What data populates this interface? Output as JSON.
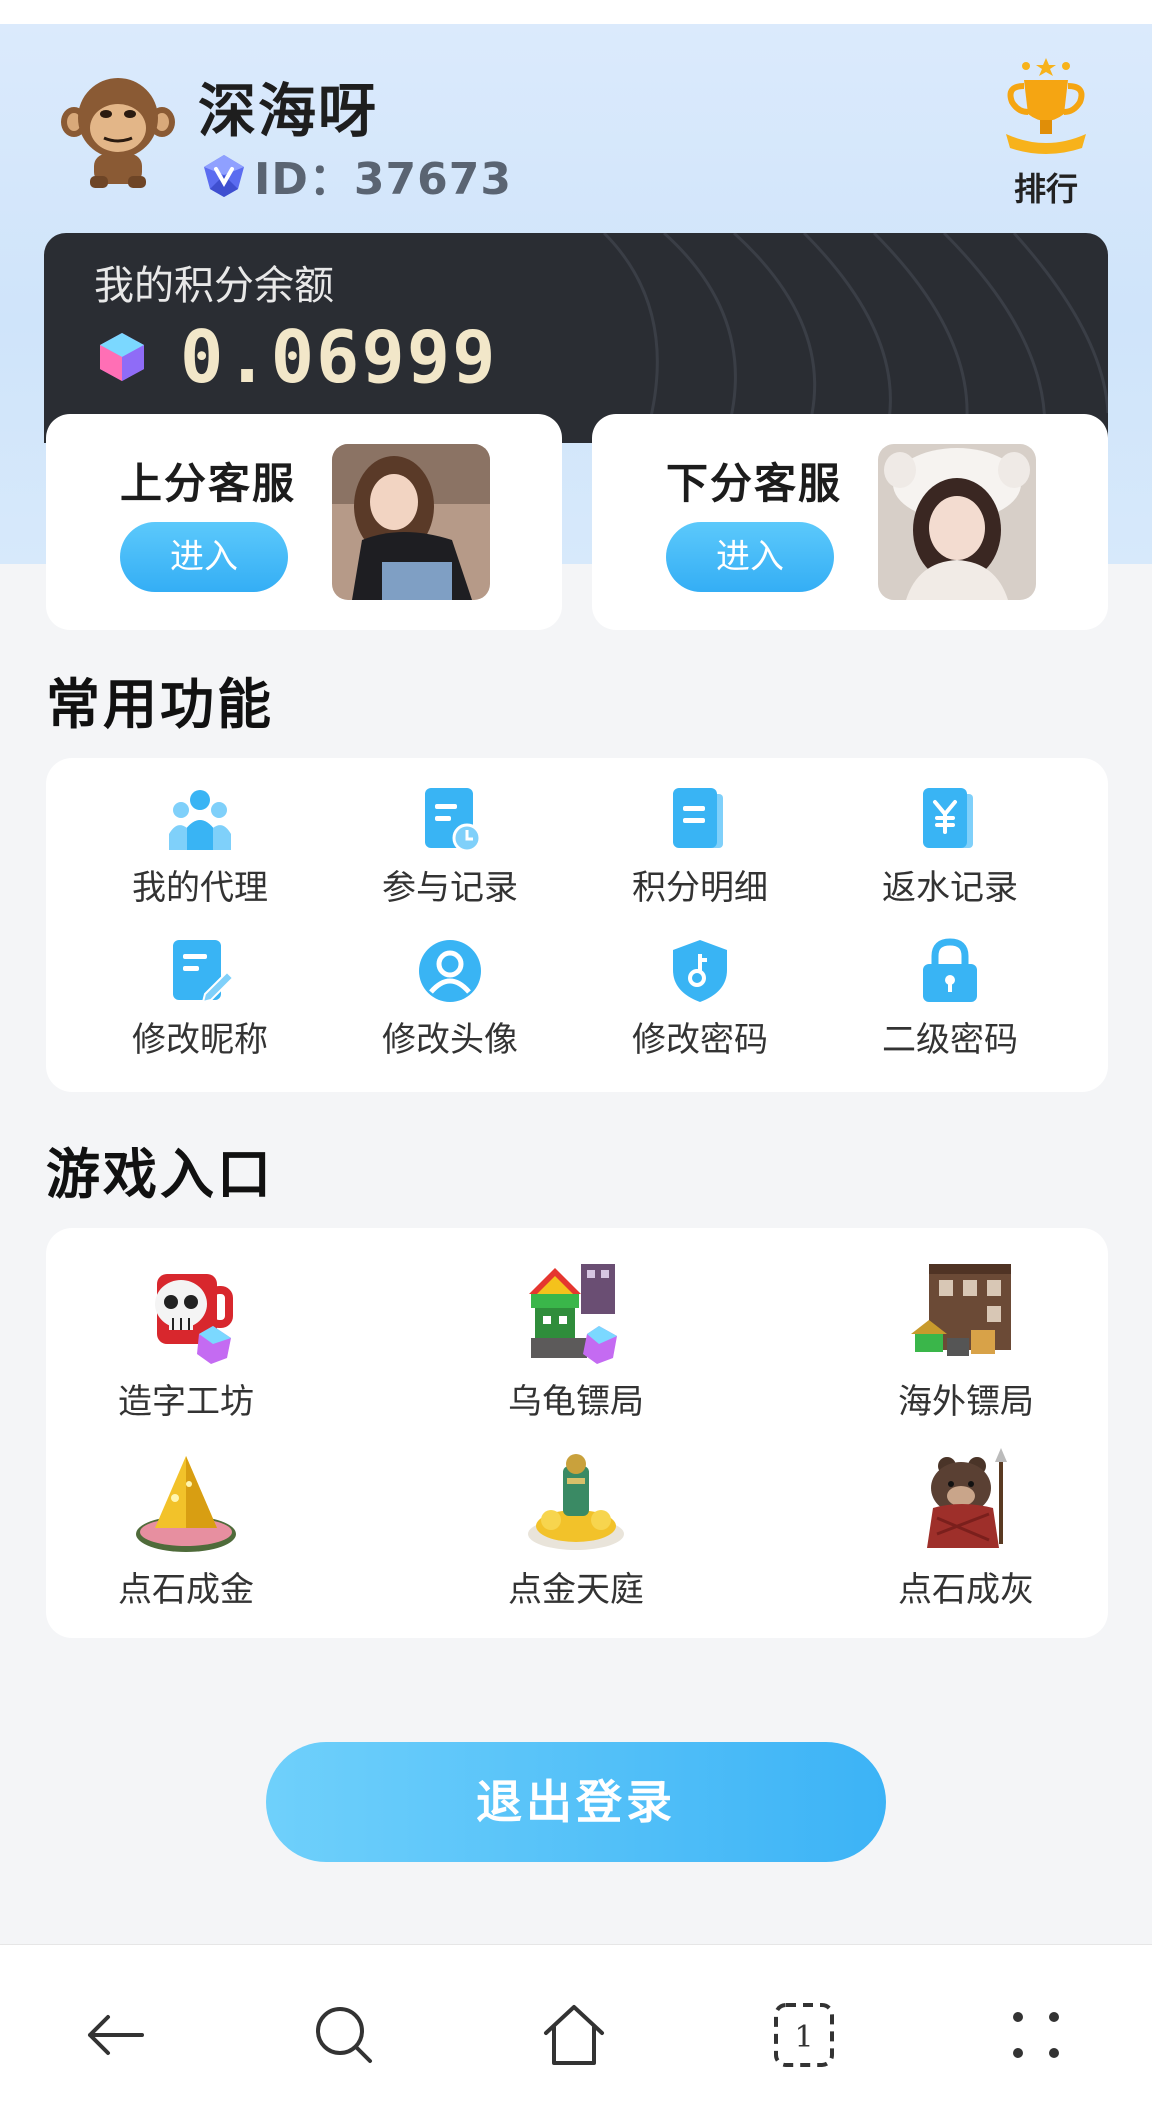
{
  "profile": {
    "username": "深海呀",
    "id_text": "ID：37673",
    "rank_label": "排行"
  },
  "balance": {
    "label": "我的积分余额",
    "value": "0.06999"
  },
  "service": {
    "top_up": {
      "title": "上分客服",
      "button": "进入"
    },
    "withdraw": {
      "title": "下分客服",
      "button": "进入"
    }
  },
  "functions": {
    "title": "常用功能",
    "items": [
      {
        "label": "我的代理",
        "icon": "users-icon"
      },
      {
        "label": "参与记录",
        "icon": "record-clock-icon"
      },
      {
        "label": "积分明细",
        "icon": "points-detail-icon"
      },
      {
        "label": "返水记录",
        "icon": "rebate-yen-icon"
      },
      {
        "label": "修改昵称",
        "icon": "edit-doc-icon"
      },
      {
        "label": "修改头像",
        "icon": "user-circle-icon"
      },
      {
        "label": "修改密码",
        "icon": "shield-key-icon"
      },
      {
        "label": "二级密码",
        "icon": "lock-icon"
      }
    ]
  },
  "games": {
    "title": "游戏入口",
    "items": [
      {
        "label": "造字工坊"
      },
      {
        "label": "乌龟镖局"
      },
      {
        "label": "海外镖局"
      },
      {
        "label": "点石成金"
      },
      {
        "label": "点金天庭"
      },
      {
        "label": "点石成灰"
      }
    ]
  },
  "logout_label": "退出登录",
  "colors": {
    "accent": "#3cb3f6",
    "header_bg": "#d4e7fb",
    "card_dark": "#2a2d33",
    "balance_text": "#f2e7c9",
    "icon_blue": "#39b4f4"
  },
  "nav_icons": [
    "back-arrow-icon",
    "search-icon",
    "home-icon",
    "tabs-icon",
    "menu-dots-icon"
  ],
  "nav_tab_count": "1"
}
